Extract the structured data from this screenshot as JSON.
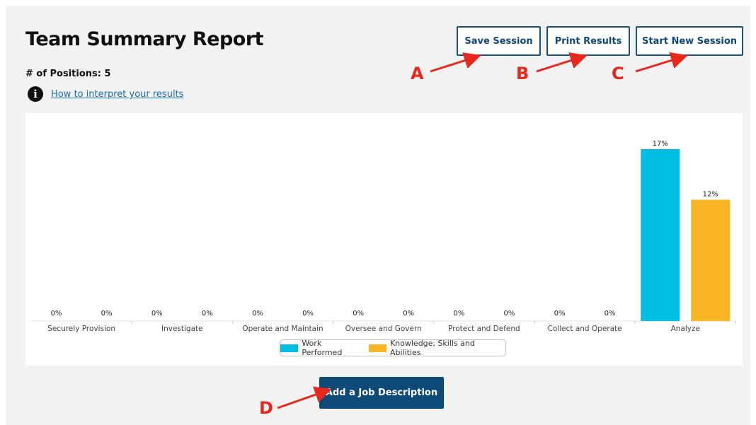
{
  "header": {
    "title": "Team Summary Report",
    "positions_label": "# of Positions: 5",
    "info_icon_glyph": "i",
    "interpret_link": "How to interpret your results"
  },
  "toolbar": {
    "save_label": "Save Session",
    "print_label": "Print Results",
    "new_session_label": "Start New Session"
  },
  "callouts": {
    "a": "A",
    "b": "B",
    "c": "C",
    "d": "D"
  },
  "colors": {
    "work_performed": "#00bde3",
    "ksa": "#fbb423",
    "primary": "#0d4a78",
    "callout": "#e8281d"
  },
  "chart_data": {
    "type": "bar",
    "categories": [
      "Securely Provision",
      "Investigate",
      "Operate and Maintain",
      "Oversee and Govern",
      "Protect and Defend",
      "Collect and Operate",
      "Analyze"
    ],
    "series": [
      {
        "name": "Work Performed",
        "values": [
          0,
          0,
          0,
          0,
          0,
          0,
          17
        ]
      },
      {
        "name": "Knowledge, Skills and Abilities",
        "values": [
          0,
          0,
          0,
          0,
          0,
          0,
          12
        ]
      }
    ],
    "value_labels": [
      [
        "0%",
        "0%",
        "0%",
        "0%",
        "0%",
        "0%",
        "17%"
      ],
      [
        "0%",
        "0%",
        "0%",
        "0%",
        "0%",
        "0%",
        "12%"
      ]
    ],
    "ylim": [
      0,
      17
    ],
    "legend": "bottom",
    "grid": false
  },
  "footer": {
    "add_job_label": "Add a Job Description"
  }
}
